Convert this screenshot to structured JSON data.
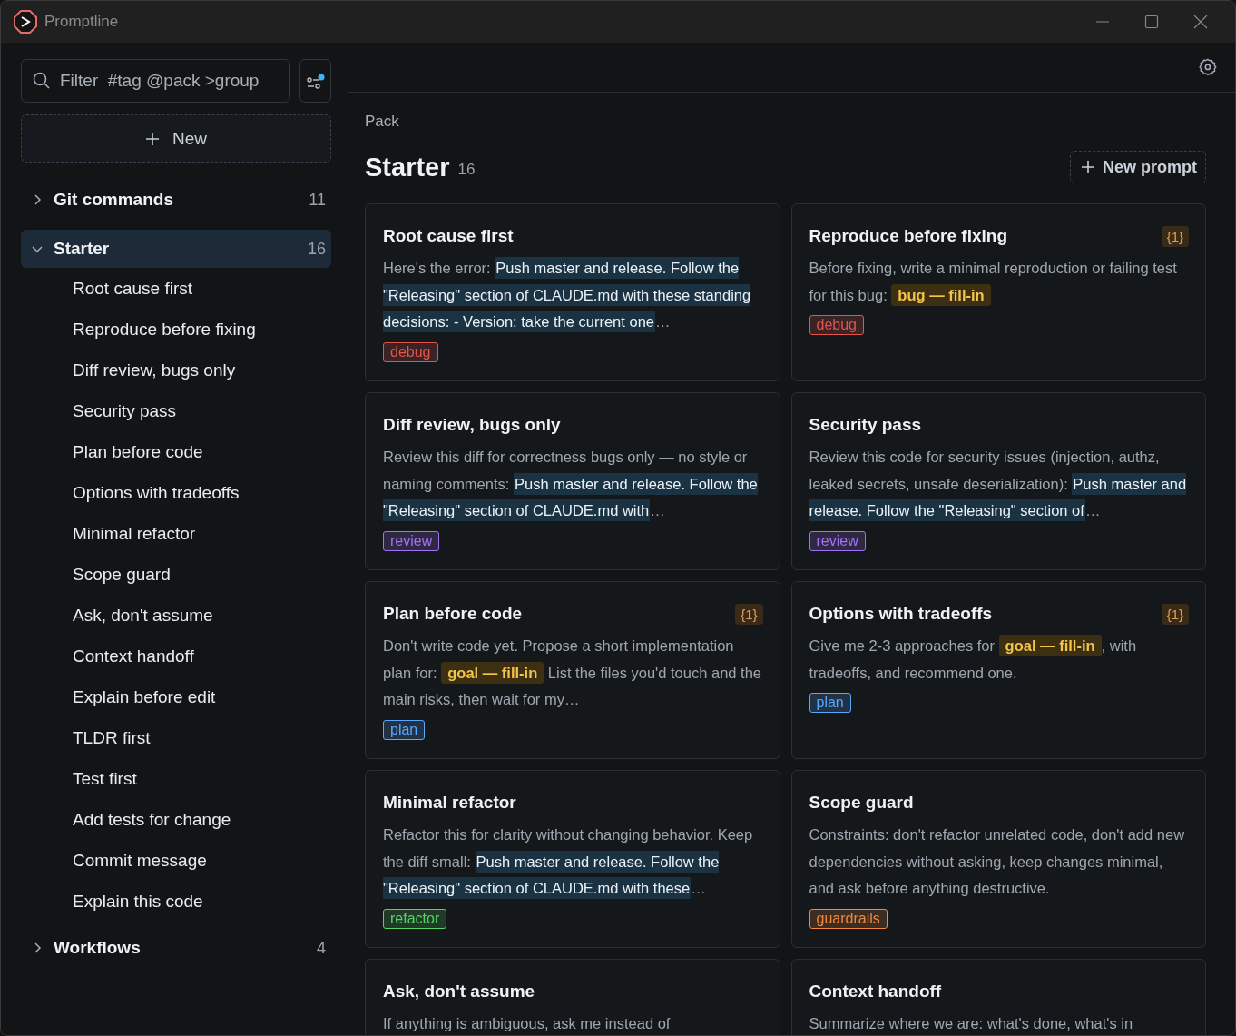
{
  "window": {
    "title": "Promptline"
  },
  "sidebar": {
    "filter": {
      "placeholder": "Filter  #tag @pack >group"
    },
    "new_button": "New",
    "groups": [
      {
        "name": "Git commands",
        "count": "11",
        "expanded": false,
        "selected": false
      },
      {
        "name": "Starter",
        "count": "16",
        "expanded": true,
        "selected": true,
        "children": [
          "Root cause first",
          "Reproduce before fixing",
          "Diff review, bugs only",
          "Security pass",
          "Plan before code",
          "Options with tradeoffs",
          "Minimal refactor",
          "Scope guard",
          "Ask, don't assume",
          "Context handoff",
          "Explain before edit",
          "TLDR first",
          "Test first",
          "Add tests for change",
          "Commit message",
          "Explain this code"
        ]
      },
      {
        "name": "Workflows",
        "count": "4",
        "expanded": false,
        "selected": false
      }
    ]
  },
  "main": {
    "label": "Pack",
    "title": "Starter",
    "count": "16",
    "new_button": "New prompt",
    "cards": [
      {
        "title": "Root cause first",
        "body": [
          {
            "kind": "text",
            "text": "Here's the error: "
          },
          {
            "kind": "snippet",
            "text": "Push master and release. Follow the \"Releasing\" section of CLAUDE.md with these standing decisions: - Version: take the current one"
          },
          {
            "kind": "text",
            "text": "…"
          }
        ],
        "tag": {
          "text": "debug",
          "color": "#e5534b"
        }
      },
      {
        "title": "Reproduce before fixing",
        "variables": "{1}",
        "body": [
          {
            "kind": "text",
            "text": "Before fixing, write a minimal reproduction or failing test for this bug: "
          },
          {
            "kind": "fill",
            "text": "bug — fill-in"
          }
        ],
        "tag": {
          "text": "debug",
          "color": "#e5534b"
        }
      },
      {
        "title": "Diff review, bugs only",
        "body": [
          {
            "kind": "text",
            "text": "Review this diff for correctness bugs only — no style or naming comments: "
          },
          {
            "kind": "snippet",
            "text": "Push master and release. Follow the \"Releasing\" section of CLAUDE.md with"
          },
          {
            "kind": "text",
            "text": "…"
          }
        ],
        "tag": {
          "text": "review",
          "color": "#a371f7"
        }
      },
      {
        "title": "Security pass",
        "body": [
          {
            "kind": "text",
            "text": "Review this code for security issues (injection, authz, leaked secrets, unsafe deserialization): "
          },
          {
            "kind": "snippet",
            "text": "Push master and release. Follow the \"Releasing\" section of"
          },
          {
            "kind": "text",
            "text": "…"
          }
        ],
        "tag": {
          "text": "review",
          "color": "#a371f7"
        }
      },
      {
        "title": "Plan before code",
        "variables": "{1}",
        "body": [
          {
            "kind": "text",
            "text": "Don't write code yet. Propose a short implementation plan for: "
          },
          {
            "kind": "fill",
            "text": "goal — fill-in"
          },
          {
            "kind": "text",
            "text": " List the files you'd touch and the main risks, then wait for my…"
          }
        ],
        "tag": {
          "text": "plan",
          "color": "#58a6ff"
        }
      },
      {
        "title": "Options with tradeoffs",
        "variables": "{1}",
        "body": [
          {
            "kind": "text",
            "text": "Give me 2-3 approaches for "
          },
          {
            "kind": "fill",
            "text": "goal — fill-in"
          },
          {
            "kind": "text",
            "text": ", with tradeoffs, and recommend one."
          }
        ],
        "tag": {
          "text": "plan",
          "color": "#58a6ff"
        }
      },
      {
        "title": "Minimal refactor",
        "body": [
          {
            "kind": "text",
            "text": "Refactor this for clarity without changing behavior. Keep the diff small: "
          },
          {
            "kind": "snippet",
            "text": "Push master and release. Follow the \"Releasing\" section of CLAUDE.md with these"
          },
          {
            "kind": "text",
            "text": "…"
          }
        ],
        "tag": {
          "text": "refactor",
          "color": "#56d364"
        }
      },
      {
        "title": "Scope guard",
        "body": [
          {
            "kind": "text",
            "text": "Constraints: don't refactor unrelated code, don't add new dependencies without asking, keep changes minimal, and ask before anything destructive."
          }
        ],
        "tag": {
          "text": "guardrails",
          "color": "#f0883e"
        }
      },
      {
        "title": "Ask, don't assume",
        "body": [
          {
            "kind": "text",
            "text": "If anything is ambiguous, ask me instead of"
          }
        ]
      },
      {
        "title": "Context handoff",
        "body": [
          {
            "kind": "text",
            "text": "Summarize where we are: what's done, what's in"
          }
        ]
      }
    ]
  }
}
